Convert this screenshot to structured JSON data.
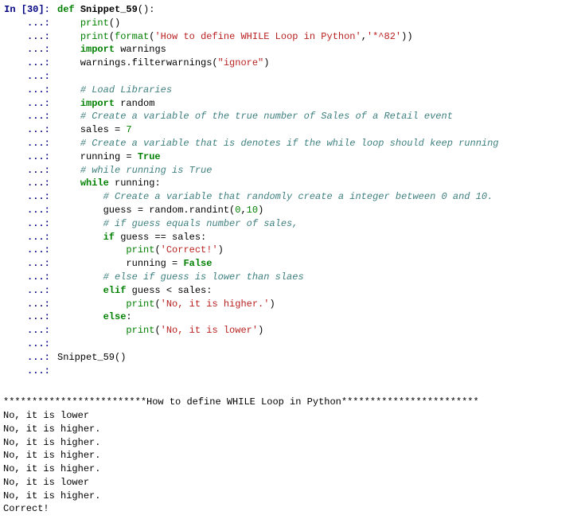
{
  "input": {
    "prompt_label": "In [",
    "prompt_num": "30",
    "prompt_close": "]: ",
    "cont": "   ...: ",
    "lines": [
      {
        "indent": 0,
        "t": "def",
        "v": {
          "def": "def",
          "name": "Snippet_59",
          "paren": "():"
        }
      },
      {
        "indent": 1,
        "t": "call",
        "v": {
          "fn": "print",
          "paren": "()"
        }
      },
      {
        "indent": 1,
        "t": "print_format",
        "v": {
          "fn": "print",
          "open": "(",
          "fmt": "format",
          "op2": "(",
          "s1": "'How to define WHILE Loop in Python'",
          "comma": ",",
          "s2": "'*^82'",
          "close": "))"
        }
      },
      {
        "indent": 1,
        "t": "import",
        "v": {
          "kw": "import",
          "mod": "warnings"
        }
      },
      {
        "indent": 1,
        "t": "plain",
        "v": {
          "pre": "warnings.filterwarnings(",
          "s": "\"ignore\"",
          "post": ")"
        }
      },
      {
        "indent": 0,
        "t": "blank"
      },
      {
        "indent": 1,
        "t": "comment",
        "v": "# Load Libraries"
      },
      {
        "indent": 1,
        "t": "import",
        "v": {
          "kw": "import",
          "mod": "random"
        }
      },
      {
        "indent": 1,
        "t": "comment",
        "v": "# Create a variable of the true number of Sales of a Retail event"
      },
      {
        "indent": 1,
        "t": "assign_num",
        "v": {
          "lhs": "sales = ",
          "num": "7"
        }
      },
      {
        "indent": 1,
        "t": "comment",
        "v": "# Create a variable that is denotes if the while loop should keep running"
      },
      {
        "indent": 1,
        "t": "assign_bool",
        "v": {
          "lhs": "running = ",
          "bool": "True"
        }
      },
      {
        "indent": 1,
        "t": "comment",
        "v": "# while running is True"
      },
      {
        "indent": 1,
        "t": "while",
        "v": {
          "kw": "while",
          "rest": " running:"
        }
      },
      {
        "indent": 2,
        "t": "comment",
        "v": "# Create a variable that randomly create a integer between 0 and 10."
      },
      {
        "indent": 2,
        "t": "assign_call2",
        "v": {
          "lhs": "guess = random.randint(",
          "n1": "0",
          "comma": ",",
          "n2": "10",
          "close": ")"
        }
      },
      {
        "indent": 2,
        "t": "comment",
        "v": "# if guess equals number of sales,"
      },
      {
        "indent": 2,
        "t": "if",
        "v": {
          "kw": "if",
          "rest": " guess == sales:"
        }
      },
      {
        "indent": 3,
        "t": "print_s",
        "v": {
          "fn": "print",
          "open": "(",
          "s": "'Correct!'",
          "close": ")"
        }
      },
      {
        "indent": 3,
        "t": "assign_bool",
        "v": {
          "lhs": "running = ",
          "bool": "False"
        }
      },
      {
        "indent": 2,
        "t": "comment",
        "v": "# else if guess is lower than slaes"
      },
      {
        "indent": 2,
        "t": "elif",
        "v": {
          "kw": "elif",
          "rest": " guess < sales:"
        }
      },
      {
        "indent": 3,
        "t": "print_s",
        "v": {
          "fn": "print",
          "open": "(",
          "s": "'No, it is higher.'",
          "close": ")"
        }
      },
      {
        "indent": 2,
        "t": "else",
        "v": {
          "kw": "else",
          "rest": ":"
        }
      },
      {
        "indent": 3,
        "t": "print_s",
        "v": {
          "fn": "print",
          "open": "(",
          "s": "'No, it is lower'",
          "close": ")"
        }
      },
      {
        "indent": 0,
        "t": "blank"
      },
      {
        "indent": 0,
        "t": "plaincall",
        "v": "Snippet_59()"
      },
      {
        "indent": 0,
        "t": "blank"
      }
    ]
  },
  "output": {
    "blank": "",
    "banner": "*************************How to define WHILE Loop in Python************************",
    "lines": [
      "No, it is lower",
      "No, it is higher.",
      "No, it is higher.",
      "No, it is higher.",
      "No, it is higher.",
      "No, it is lower",
      "No, it is higher.",
      "Correct!"
    ]
  }
}
